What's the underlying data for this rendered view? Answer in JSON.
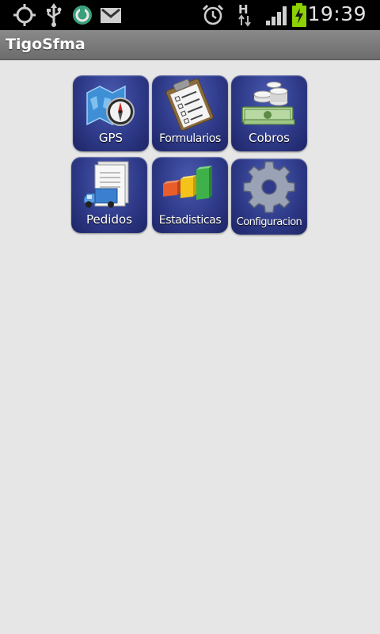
{
  "status_bar": {
    "time": "19:39",
    "network_type": "H",
    "icons": [
      "gps-icon",
      "usb-icon",
      "sync-icon",
      "gmail-icon",
      "alarm-icon",
      "data-transfer-icon",
      "signal-icon",
      "battery-charging-icon"
    ]
  },
  "title_bar": {
    "title": "TigoSfma"
  },
  "menu": {
    "items": [
      {
        "label": "GPS",
        "icon": "map-compass-icon"
      },
      {
        "label": "Formularios",
        "icon": "clipboard-form-icon"
      },
      {
        "label": "Cobros",
        "icon": "money-coins-icon"
      },
      {
        "label": "Pedidos",
        "icon": "delivery-truck-icon"
      },
      {
        "label": "Estadisticas",
        "icon": "bar-chart-icon"
      },
      {
        "label": "Configuracion",
        "icon": "gear-icon"
      }
    ]
  },
  "colors": {
    "tile_background": "#2f3b8a",
    "page_background": "#e6e6e6",
    "title_bar": "#7a7a7a",
    "status_bar": "#000000",
    "battery": "#8cd100"
  }
}
